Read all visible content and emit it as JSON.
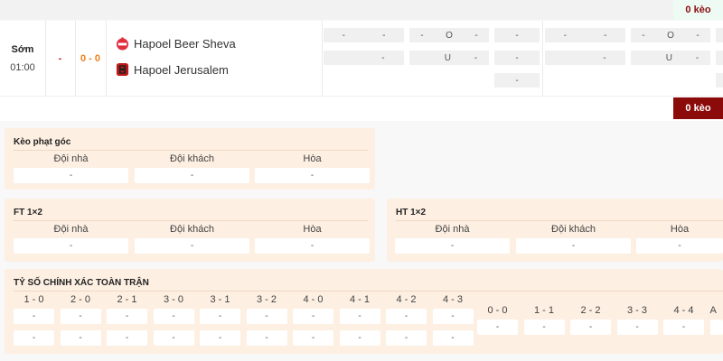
{
  "header": {
    "keo_count": "0 kèo"
  },
  "match": {
    "status": "Sớm",
    "time": "01:00",
    "red_mark": "-",
    "score": "0 - 0",
    "home": "Hapoel Beer Sheva",
    "away": "Hapoel Jerusalem",
    "odds_group1": {
      "row1": [
        [
          "-",
          "-"
        ],
        [
          "-",
          "O",
          "-"
        ],
        [
          "-"
        ]
      ],
      "row2": [
        [
          "",
          "-"
        ],
        [
          "",
          "U",
          "-"
        ],
        [
          "-"
        ]
      ],
      "row3": [
        "-"
      ]
    },
    "odds_group2": {
      "row1": [
        [
          "-",
          "-"
        ],
        [
          "-",
          "O",
          "-"
        ],
        [
          ""
        ]
      ],
      "row2": [
        [
          "",
          "-"
        ],
        [
          "",
          "U",
          "-"
        ],
        [
          ""
        ]
      ],
      "row3": [
        ""
      ]
    },
    "keo_button": "0 kèo"
  },
  "corner": {
    "title": "Kèo phạt góc",
    "labels": [
      "Đội nhà",
      "Đội khách",
      "Hòa"
    ],
    "values": [
      "-",
      "-",
      "-"
    ]
  },
  "ft": {
    "title": "FT 1×2",
    "labels": [
      "Đội nhà",
      "Đội khách",
      "Hòa"
    ],
    "values": [
      "-",
      "-",
      "-"
    ]
  },
  "ht": {
    "title": "HT 1×2",
    "labels": [
      "Đội nhà",
      "Đội khách",
      "Hòa"
    ],
    "values": [
      "-",
      "-",
      "-"
    ]
  },
  "exact": {
    "title": "TỶ SỐ CHÍNH XÁC TOÀN TRẬN",
    "left": [
      {
        "s": "1 - 0",
        "a": "-",
        "b": "-"
      },
      {
        "s": "2 - 0",
        "a": "-",
        "b": "-"
      },
      {
        "s": "2 - 1",
        "a": "-",
        "b": "-"
      },
      {
        "s": "3 - 0",
        "a": "-",
        "b": "-"
      },
      {
        "s": "3 - 1",
        "a": "-",
        "b": "-"
      },
      {
        "s": "3 - 2",
        "a": "-",
        "b": "-"
      },
      {
        "s": "4 - 0",
        "a": "-",
        "b": "-"
      },
      {
        "s": "4 - 1",
        "a": "-",
        "b": "-"
      },
      {
        "s": "4 - 2",
        "a": "-",
        "b": "-"
      },
      {
        "s": "4 - 3",
        "a": "-",
        "b": "-"
      }
    ],
    "draws": [
      {
        "s": "0 - 0",
        "a": "-"
      },
      {
        "s": "1 - 1",
        "a": "-"
      },
      {
        "s": "2 - 2",
        "a": "-"
      },
      {
        "s": "3 - 3",
        "a": "-"
      },
      {
        "s": "4 - 4",
        "a": "-"
      },
      {
        "s": "A",
        "a": ""
      }
    ]
  },
  "colors": {
    "accent": "#8b0a0a",
    "score": "#f08020",
    "panel": "#fdefe2"
  }
}
